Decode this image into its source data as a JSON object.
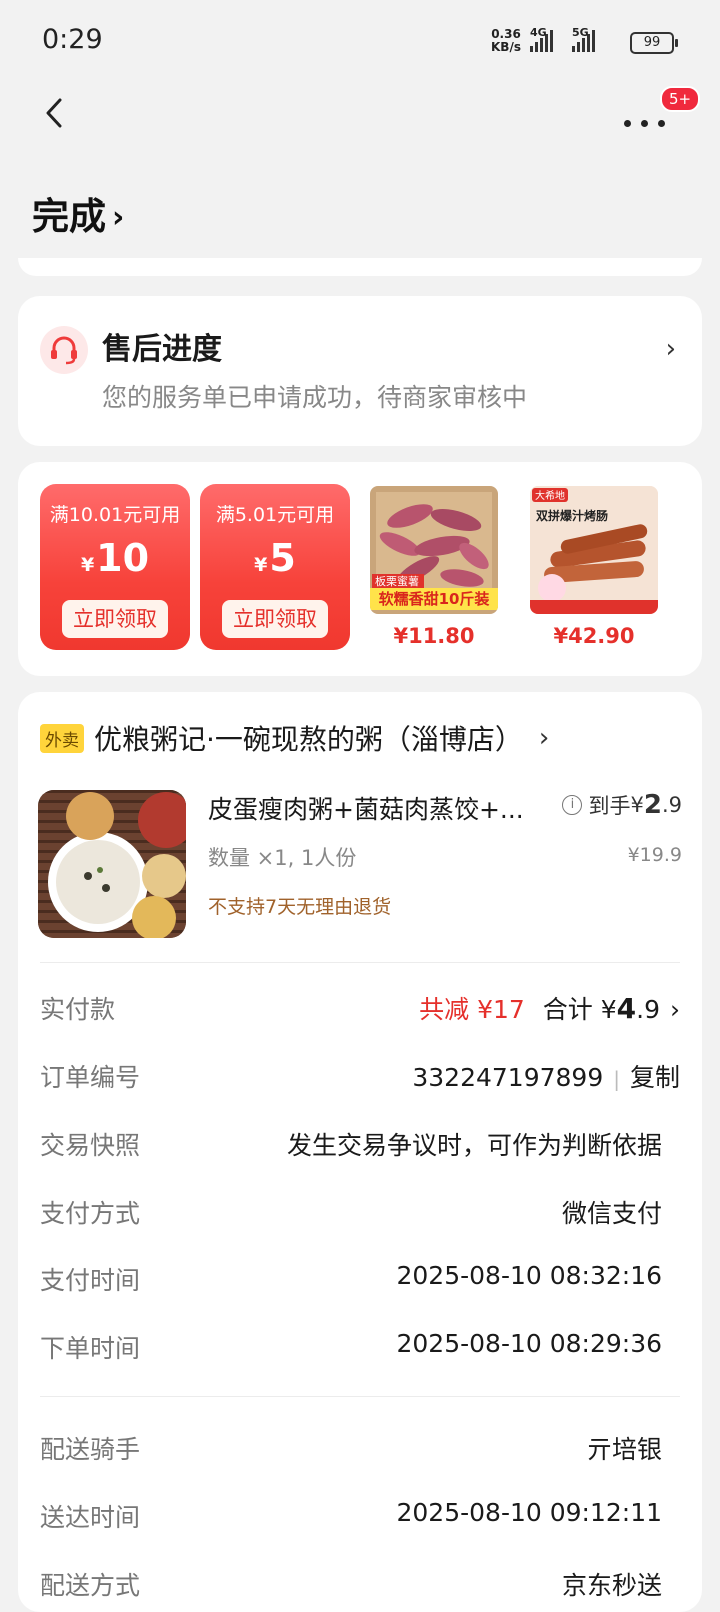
{
  "status_bar": {
    "time": "0:29",
    "net_speed": "0.36",
    "net_unit": "KB/s",
    "sim1": "4G",
    "sim2": "5G",
    "battery": "99"
  },
  "header": {
    "badge": "5+",
    "status_title": "完成"
  },
  "after_sales": {
    "title": "售后进度",
    "subtitle": "您的服务单已申请成功，待商家审核中"
  },
  "promos": {
    "coupons": [
      {
        "condition": "满10.01元可用",
        "currency": "¥",
        "amount": "10",
        "button": "立即领取"
      },
      {
        "condition": "满5.01元可用",
        "currency": "¥",
        "amount": "5",
        "button": "立即领取"
      }
    ],
    "products": [
      {
        "badge_top": "板栗蜜薯",
        "banner": "软糯香甜10斤装",
        "price": "¥11.80"
      },
      {
        "brand": "大希地",
        "title": "双拼爆汁烤肠",
        "price": "¥42.90"
      }
    ]
  },
  "order": {
    "shop_tag": "外卖",
    "shop_name": "优粮粥记·一碗现熬的粥（淄博店）",
    "item": {
      "name": "皮蛋瘦肉粥+菌菇肉蒸饺+...",
      "quantity": "数量 ×1, 1人份",
      "note": "不支持7天无理由退货",
      "price_prefix": "到手",
      "price_currency": "¥",
      "price_int": "2",
      "price_dec": ".9",
      "original_price": "¥19.9"
    },
    "paid": {
      "label": "实付款",
      "reduction": "共减 ¥17",
      "total_prefix": "合计 ¥",
      "total_int": "4",
      "total_dec": ".9"
    },
    "details": [
      {
        "label": "订单编号",
        "value": "332247197899",
        "action": "复制"
      },
      {
        "label": "交易快照",
        "value": "发生交易争议时，可作为判断依据"
      },
      {
        "label": "支付方式",
        "value": "微信支付"
      },
      {
        "label": "支付时间",
        "value": "2025-08-10 08:32:16"
      },
      {
        "label": "下单时间",
        "value": "2025-08-10 08:29:36"
      }
    ],
    "delivery": [
      {
        "label": "配送骑手",
        "value": "亓培银"
      },
      {
        "label": "送达时间",
        "value": "2025-08-10 09:12:11"
      },
      {
        "label": "配送方式",
        "value": "京东秒送"
      }
    ]
  }
}
